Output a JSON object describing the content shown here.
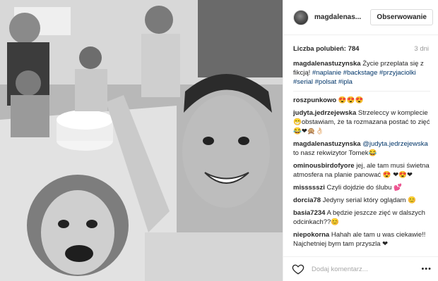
{
  "photo": {
    "alt_name": "selfie-photo"
  },
  "header": {
    "username": "magdalenas...",
    "follow_label": "Obserwowanie"
  },
  "likes": {
    "label": "Liczba polubień:",
    "count": "784",
    "date": "3 dni"
  },
  "caption": {
    "user": "magdalenastuzynska",
    "text": "Życie przeplata się z fikcją!",
    "tags": "#naplanie #backstage #przyjaciolki #serial #polsat #ipla"
  },
  "comments": [
    {
      "user": "roszpunkowo",
      "text": "😍😍😍"
    },
    {
      "user": "judyta.jedrzejewska",
      "text": "Strzeleccy w komplecie 😁obstawiam, że ta rozmazana postać to zięć 😂❤🙊👌🏻"
    },
    {
      "user": "magdalenastuzynska",
      "mention": "@judyta.jedrzejewska",
      "text": "to nasz rekwizytor Tomek😂"
    },
    {
      "user": "ominousbirdofyore",
      "text": "jej, ale tam musi świetna atmosfera na planie panować 😍 ❤😍❤"
    },
    {
      "user": "missssszi",
      "text": "Czyli dojdzie do ślubu 💕"
    },
    {
      "user": "dorcia78",
      "text": "Jedyny serial który oglądam 😊"
    },
    {
      "user": "basia7234",
      "text": "A będzie jeszcze zięć w dalszych odcinkach??😊"
    },
    {
      "user": "niepokorna",
      "text": "Hahah ale tam u was ciekawie!! Najchetniej bym tam przyszla ❤"
    }
  ],
  "footer": {
    "placeholder": "Dodaj komentarz...",
    "more_label": "•••"
  },
  "icons": {
    "heart": "heart-icon",
    "more": "more-options-icon"
  },
  "colors": {
    "link": "#003569",
    "border": "#efefef",
    "muted": "#999999"
  }
}
